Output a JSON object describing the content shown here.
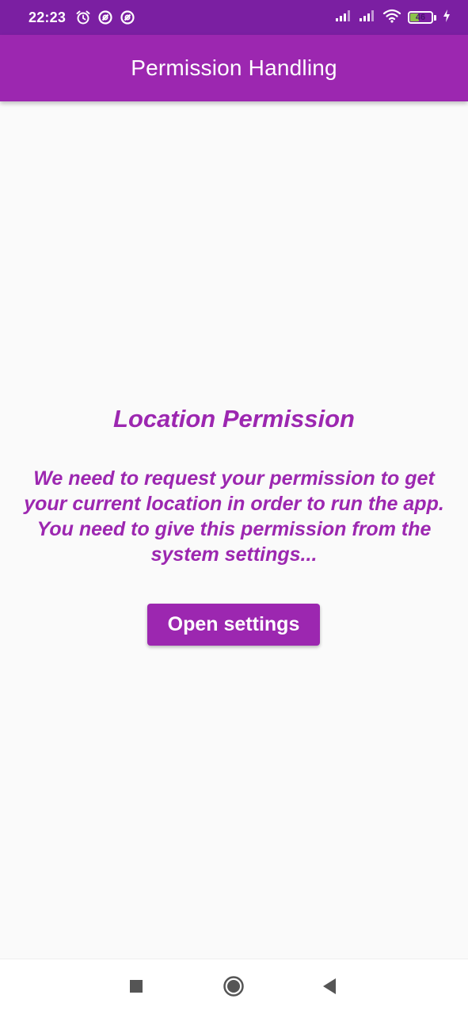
{
  "status_bar": {
    "time": "22:23",
    "battery_level": "46",
    "battery_fraction": 0.46,
    "icons": [
      "alarm-icon",
      "sync-icon",
      "sync-icon",
      "signal-icon",
      "signal-icon",
      "wifi-icon",
      "battery-icon",
      "charging-icon"
    ]
  },
  "app_bar": {
    "title": "Permission Handling"
  },
  "main": {
    "heading": "Location Permission",
    "message": "We need to request your permission to get your current location in order to run the app. You need to give this permission from the system settings...",
    "button_label": "Open settings"
  },
  "nav_bar": {
    "buttons": [
      "recents-button",
      "home-button",
      "back-button"
    ]
  },
  "colors": {
    "status_bar": "#7b1fa2",
    "primary": "#9c27b0",
    "background": "#fafafa",
    "nav_icon": "#555555"
  }
}
